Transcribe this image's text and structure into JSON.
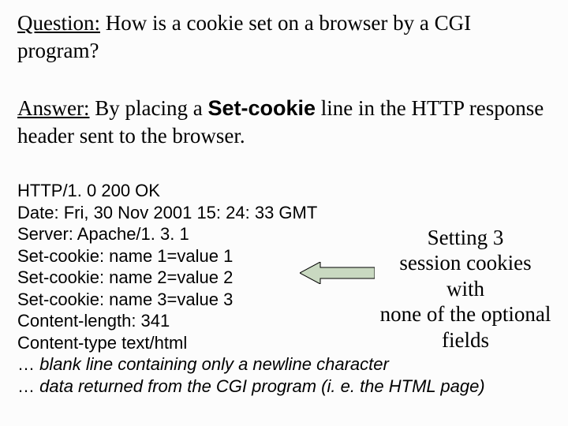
{
  "question": {
    "label": "Question:",
    "text1": " How is a cookie set on a browser by a CGI",
    "text2": "program?"
  },
  "answer": {
    "label": "Answer:",
    "pre": " By placing a ",
    "bold": "Set-cookie",
    "post1": " line in the HTTP response",
    "post2": "header sent to the browser."
  },
  "http": {
    "lines": [
      "HTTP/1. 0 200 OK",
      "Date: Fri, 30 Nov 2001 15: 24: 33 GMT",
      "Server: Apache/1. 3. 1",
      "Set-cookie: name 1=value 1",
      "Set-cookie: name 2=value 2",
      "Set-cookie: name 3=value 3",
      "Content-length: 341",
      "Content-type text/html"
    ],
    "note1_prefix": "… ",
    "note1": "blank line containing only a newline character",
    "note2_prefix": "… ",
    "note2": "data returned from the CGI program (i. e. the HTML page)"
  },
  "annotation": {
    "l1": "Setting 3",
    "l2": "session cookies with",
    "l3": "none of the optional",
    "l4": "fields"
  }
}
